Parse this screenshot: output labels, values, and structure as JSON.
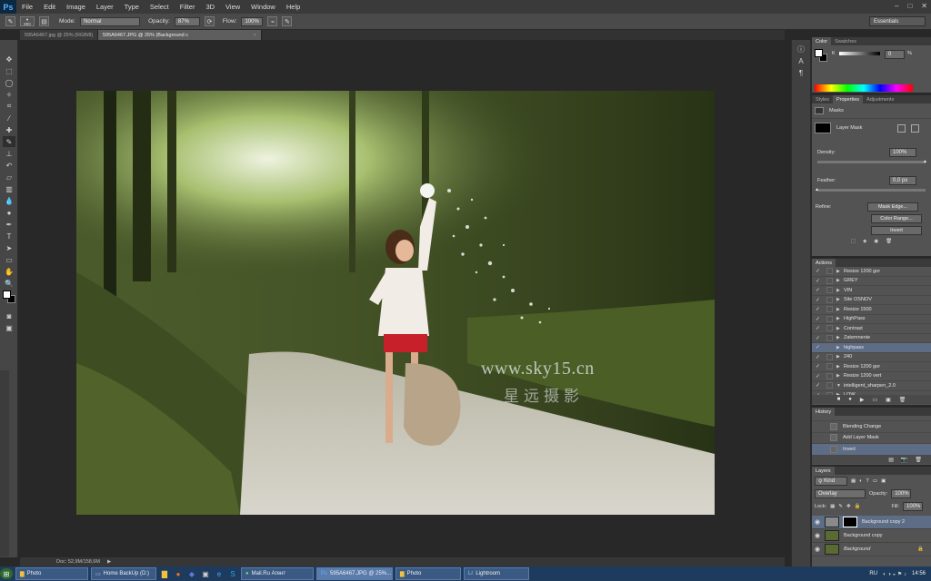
{
  "app": {
    "logo": "Ps"
  },
  "menu": [
    "File",
    "Edit",
    "Image",
    "Layer",
    "Type",
    "Select",
    "Filter",
    "3D",
    "View",
    "Window",
    "Help"
  ],
  "window_controls": [
    "–",
    "□",
    "✕"
  ],
  "options": {
    "brush_size": "800",
    "mode_label": "Mode:",
    "mode_value": "Normal",
    "opacity_label": "Opacity:",
    "opacity_value": "87%",
    "flow_label": "Flow:",
    "flow_value": "100%",
    "workspace": "Essentials"
  },
  "doc_tabs": [
    {
      "label": "595A6467.jpg @ 25% (RGB/8)",
      "active": false
    },
    {
      "label": "595A6467.JPG @ 25% (Background c",
      "active": true
    }
  ],
  "canvas": {
    "watermark_url": "www.sky15.cn",
    "watermark_cn": "星远摄影"
  },
  "status": {
    "zoom": "25%",
    "doc": "Doc: 52,9M/158,6M"
  },
  "color_panel": {
    "tabs": [
      "Color",
      "Swatches"
    ],
    "k_label": "K",
    "k_value": "0",
    "percent": "%"
  },
  "properties_panel": {
    "tabs": [
      "Styles",
      "Properties",
      "Adjustments"
    ],
    "section": "Masks",
    "layer_mask": "Layer Mask",
    "density_label": "Density:",
    "density_value": "100%",
    "density_level": 1.0,
    "feather_label": "Feather:",
    "feather_value": "0,0 px",
    "feather_level": 0.0,
    "refine_label": "Refine:",
    "mask_edge": "Mask Edge...",
    "color_range": "Color Range...",
    "invert": "Invert"
  },
  "actions_panel": {
    "title": "Actions",
    "items": [
      {
        "label": "Resize 1200 gor",
        "selected": false
      },
      {
        "label": "GREY",
        "selected": false
      },
      {
        "label": "VIN",
        "selected": false
      },
      {
        "label": "Site OSNOV",
        "selected": false
      },
      {
        "label": "Resize 1500",
        "selected": false
      },
      {
        "label": "HighPass",
        "selected": false
      },
      {
        "label": "Contrast",
        "selected": false
      },
      {
        "label": "Zatemnenie",
        "selected": false
      },
      {
        "label": "highpass",
        "selected": true
      },
      {
        "label": "240",
        "selected": false
      },
      {
        "label": "Resize 1200 gor",
        "selected": false
      },
      {
        "label": "Resize 1200 vert",
        "selected": false
      },
      {
        "label": "intelligent_sharpen_2.0",
        "selected": false
      },
      {
        "label": "LOW",
        "selected": false
      }
    ]
  },
  "history_panel": {
    "title": "History",
    "items": [
      {
        "label": "Blending Change",
        "selected": false
      },
      {
        "label": "Add Layer Mask",
        "selected": false
      },
      {
        "label": "Invert",
        "selected": true
      }
    ]
  },
  "layers_panel": {
    "title": "Layers",
    "kind": "Kind",
    "blend_mode": "Overlay",
    "opacity_label": "Opacity:",
    "opacity_value": "100%",
    "lock_label": "Lock:",
    "fill_label": "Fill:",
    "fill_value": "100%",
    "layers": [
      {
        "name": "Background copy 2",
        "selected": true,
        "has_mask": true
      },
      {
        "name": "Background copy",
        "selected": false,
        "has_mask": false
      },
      {
        "name": "Background",
        "selected": false,
        "has_mask": false
      }
    ]
  },
  "taskbar": {
    "items": [
      "Photo",
      "Home BackUp (D:)",
      "Mail.Ru Агент",
      "595A6467.JPG @ 25%...",
      "Photo",
      "Lightroom"
    ],
    "lang": "RU",
    "clock": "14:56"
  },
  "colors": {
    "selection": "#5d6d86",
    "panel_bg": "#535353",
    "ps_logo": "#5fb0ff"
  }
}
